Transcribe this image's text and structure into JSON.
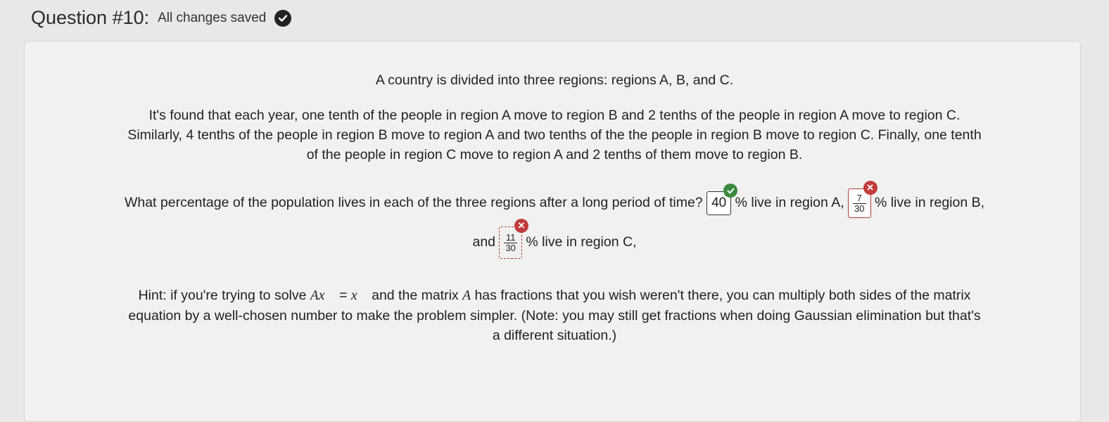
{
  "header": {
    "title": "Question #10:",
    "saved_status": "All changes saved"
  },
  "problem": {
    "intro": "A country is divided into three regions: regions A, B, and C.",
    "details_line1": "It's found that each year, one tenth of the people in region A move to region B and 2 tenths of the people in region A move to region C.",
    "details_line2": "Similarly, 4 tenths of the people in region B move to region A and two tenths of the the people in region B move to region C. Finally, one tenth",
    "details_line3": "of the people in region C move to region A and 2 tenths of them move to region B.",
    "question_prefix": "What percentage of the population lives in each of the three regions after a long period of time?",
    "label_a": "% live in region A,",
    "label_b": "% live in region B,",
    "label_and": "and",
    "label_c": "% live in region C,"
  },
  "answers": {
    "a": {
      "value": "40",
      "status": "correct"
    },
    "b": {
      "numerator": "7",
      "denominator": "30",
      "status": "incorrect"
    },
    "c": {
      "numerator": "11",
      "denominator": "30",
      "status": "incorrect"
    }
  },
  "hint": {
    "prefix": "Hint: if you're trying to solve",
    "eq_lhs": "Ax⃗",
    "eq_op": "=",
    "eq_rhs": "x⃗",
    "middle": "and the matrix",
    "matrix_var": "A",
    "suffix": "has fractions that you wish weren't there, you can multiply both sides of the matrix",
    "line2": "equation by a well-chosen number to make the problem simpler. (Note: you may still get fractions when doing Gaussian elimination but that's",
    "line3": "a different situation.)"
  },
  "colors": {
    "correct": "#3c8a3f",
    "incorrect": "#c23b3b"
  }
}
